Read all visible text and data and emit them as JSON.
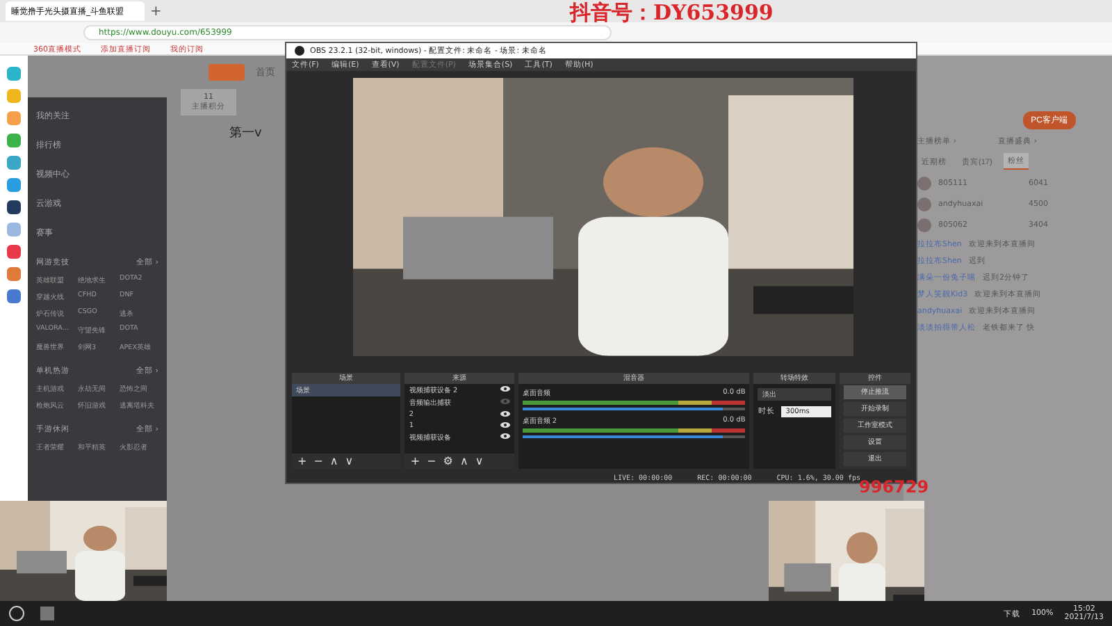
{
  "browser": {
    "tab_title": "睡觉撸手光头摄直播_斗鱼联盟",
    "new_tab": "+",
    "url": "https://www.douyu.com/653999",
    "bookmarks": [
      "360直播模式",
      "添加直播订阅",
      "我的订阅"
    ]
  },
  "overlay_text": "抖音号：DY653999",
  "site": {
    "nav": [
      "首页"
    ],
    "menu": [
      {
        "label": "我的关注"
      },
      {
        "label": "排行榜"
      },
      {
        "label": "视频中心"
      },
      {
        "label": "云游戏"
      },
      {
        "label": "赛事"
      }
    ],
    "sections": [
      {
        "title": "网游竞技",
        "more": "全部 ›",
        "games": [
          "英雄联盟",
          "绝地求生",
          "DOTA2",
          "穿越火线",
          "CFHD",
          "DNF",
          "炉石传说",
          "CSGO",
          "逃杀",
          "VALORA...",
          "守望先锋",
          "DOTA",
          "魔兽世界",
          "剑网3",
          "APEX英雄"
        ]
      },
      {
        "title": "单机热游",
        "more": "全部 ›",
        "games": [
          "主机游戏",
          "永劫无间",
          "恐怖之间",
          "枪炮风云",
          "怀旧游戏",
          "逃离塔科夫"
        ]
      },
      {
        "title": "手游休闲",
        "more": "全部 ›",
        "games": [
          "王者荣耀",
          "和平精英",
          "火影忍者"
        ]
      }
    ],
    "stats": [
      {
        "value": "11",
        "label": "主播积分"
      }
    ],
    "streamer_title": "第一v"
  },
  "chat": {
    "tabs": [
      {
        "label": "近期榜",
        "selected": false
      },
      {
        "label": "贵宾(17)",
        "selected": false
      },
      {
        "label": "粉丝",
        "selected": true
      }
    ],
    "links": [
      "主播榜单 ›",
      "直播盛典 ›"
    ],
    "client_button": "PC客户端",
    "fans": [
      {
        "name": "805111",
        "score": "6041"
      },
      {
        "name": "andyhuaxai",
        "score": "4500"
      },
      {
        "name": "805062",
        "score": "3404"
      }
    ],
    "messages": [
      {
        "user": "拉拉布Shen",
        "text": "欢迎来到本直播间"
      },
      {
        "user": "拉拉布Shen",
        "text": "迟到"
      },
      {
        "user": "满朵一份兔子喵",
        "text": "迟到2分钟了"
      },
      {
        "user": "梦人笑靓Kid3",
        "text": "欢迎来到本直播间"
      },
      {
        "user": "andyhuaxai",
        "text": "欢迎来到本直播间"
      },
      {
        "user": "淡淡拍得带人松",
        "text": "老铁都来了 快"
      }
    ]
  },
  "obs": {
    "title": "OBS 23.2.1 (32-bit, windows) - 配置文件: 未命名 - 场景: 未命名",
    "menu": [
      {
        "label": "文件(F)",
        "disabled": false
      },
      {
        "label": "编辑(E)",
        "disabled": false
      },
      {
        "label": "查看(V)",
        "disabled": false
      },
      {
        "label": "配置文件(P)",
        "disabled": true
      },
      {
        "label": "场景集合(S)",
        "disabled": false
      },
      {
        "label": "工具(T)",
        "disabled": false
      },
      {
        "label": "帮助(H)",
        "disabled": false
      }
    ],
    "docks": {
      "scenes": {
        "title": "场景",
        "items": [
          {
            "label": "场景",
            "selected": true
          }
        ],
        "tools": [
          "+",
          "−",
          "∧",
          "∨"
        ]
      },
      "sources": {
        "title": "来源",
        "items": [
          {
            "label": "视频捕获设备 2",
            "visible": true
          },
          {
            "label": "音频输出捕获",
            "visible": false
          },
          {
            "label": "2",
            "visible": true
          },
          {
            "label": "1",
            "visible": true
          },
          {
            "label": "视频捕获设备",
            "visible": true
          }
        ],
        "tools": [
          "+",
          "−",
          "⚙",
          "∧",
          "∨"
        ]
      },
      "mixer": {
        "title": "混音器",
        "channels": [
          {
            "name": "桌面音频",
            "reading": "0.0 dB",
            "level": 0.9
          },
          {
            "name": "桌面音频 2",
            "reading": "0.0 dB",
            "level": 0.9
          }
        ]
      },
      "transitions": {
        "title": "转场特效",
        "value": "淡出",
        "duration_label": "时长",
        "duration": "300ms"
      },
      "controls": {
        "title": "控件",
        "buttons": [
          {
            "label": "停止推流",
            "active": true
          },
          {
            "label": "开始录制",
            "active": false
          },
          {
            "label": "工作室模式",
            "active": false
          },
          {
            "label": "设置",
            "active": false
          },
          {
            "label": "退出",
            "active": false
          }
        ]
      }
    },
    "status": [
      "LIVE: 00:00:00",
      "REC: 00:00:00",
      "CPU: 1.6%, 30.00 fps"
    ]
  },
  "bottom_overlay_text": "996729",
  "taskbar": {
    "tray": [
      "下载",
      "100%"
    ],
    "time": "15:02",
    "date": "2021/7/13"
  }
}
